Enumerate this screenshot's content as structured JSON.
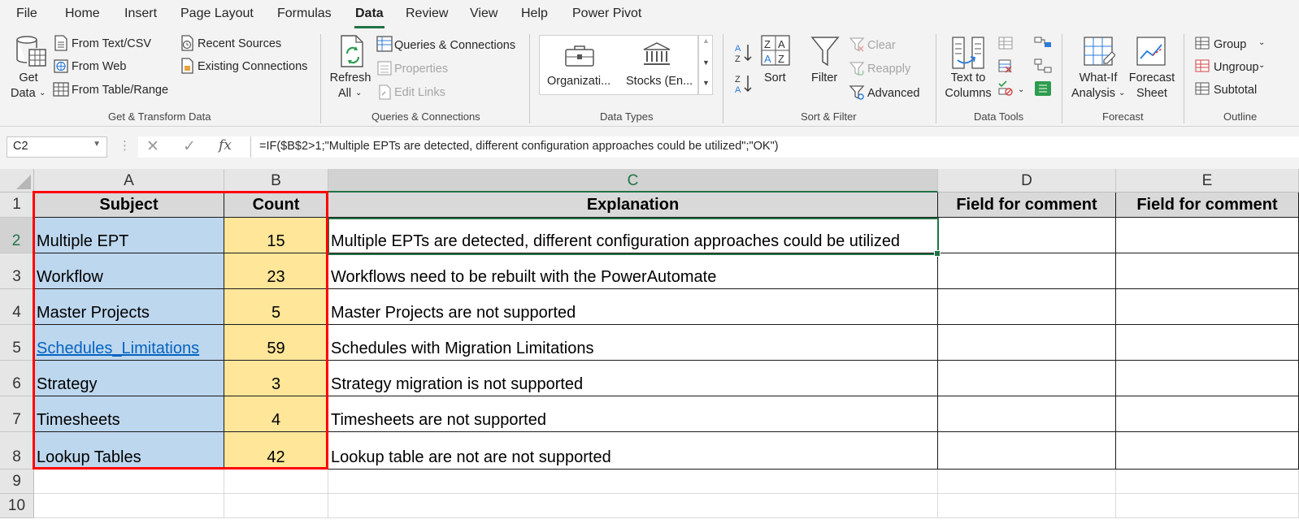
{
  "tabs": [
    "File",
    "Home",
    "Insert",
    "Page Layout",
    "Formulas",
    "Data",
    "Review",
    "View",
    "Help",
    "Power Pivot"
  ],
  "active_tab": "Data",
  "ribbon": {
    "get_transform": {
      "get_data_line1": "Get",
      "get_data_line2": "Data",
      "from_text_csv": "From Text/CSV",
      "from_web": "From Web",
      "from_table_range": "From Table/Range",
      "recent_sources": "Recent Sources",
      "existing_connections": "Existing Connections",
      "group_label": "Get & Transform Data"
    },
    "queries": {
      "refresh_line1": "Refresh",
      "refresh_line2": "All",
      "queries_connections": "Queries & Connections",
      "properties": "Properties",
      "edit_links": "Edit Links",
      "group_label": "Queries & Connections"
    },
    "data_types": {
      "organization": "Organizati...",
      "stocks": "Stocks (En...",
      "group_label": "Data Types"
    },
    "sort_filter": {
      "sort": "Sort",
      "filter": "Filter",
      "clear": "Clear",
      "reapply": "Reapply",
      "advanced": "Advanced",
      "group_label": "Sort & Filter"
    },
    "data_tools": {
      "text_to_columns_line1": "Text to",
      "text_to_columns_line2": "Columns",
      "group_label": "Data Tools"
    },
    "forecast": {
      "what_if_line1": "What-If",
      "what_if_line2": "Analysis",
      "forecast_sheet_line1": "Forecast",
      "forecast_sheet_line2": "Sheet",
      "group_label": "Forecast"
    },
    "outline": {
      "group": "Group",
      "ungroup": "Ungroup",
      "subtotal": "Subtotal",
      "group_label": "Outline"
    }
  },
  "formula_bar": {
    "name_box": "C2",
    "fx": "fx",
    "formula": "=IF($B$2>1;\"Multiple EPTs are detected, different configuration approaches could be utilized\";\"OK\")"
  },
  "sheet": {
    "columns": [
      "A",
      "B",
      "C",
      "D",
      "E"
    ],
    "row_numbers": [
      "1",
      "2",
      "3",
      "4",
      "5",
      "6",
      "7",
      "8",
      "9",
      "10"
    ],
    "headers": {
      "subject": "Subject",
      "count": "Count",
      "explanation": "Explanation",
      "comment_d": "Field for comment",
      "comment_e": "Field for comment"
    },
    "rows": [
      {
        "subject": "Multiple EPT",
        "count": "15",
        "explanation": "Multiple EPTs are detected, different configuration approaches could be utilized"
      },
      {
        "subject": "Workflow",
        "count": "23",
        "explanation": "Workflows need to be rebuilt with the PowerAutomate"
      },
      {
        "subject": "Master Projects",
        "count": "5",
        "explanation": "Master Projects are not supported"
      },
      {
        "subject": "Schedules_Limitations",
        "count": "59",
        "explanation": "Schedules with Migration Limitations"
      },
      {
        "subject": "Strategy",
        "count": "3",
        "explanation": "Strategy migration is not supported"
      },
      {
        "subject": "Timesheets",
        "count": "4",
        "explanation": "Timesheets are not supported"
      },
      {
        "subject": "Lookup Tables",
        "count": "42",
        "explanation": "Lookup table are not are not supported"
      }
    ],
    "active_cell": "C2",
    "hyperlink_row": "Schedules_Limitations",
    "colors": {
      "subject_fill": "#bdd7ee",
      "count_fill": "#ffe699",
      "header_fill": "#d9d9d9",
      "highlight_border": "#ff0000",
      "excel_green": "#217346",
      "link": "#0563c1"
    }
  }
}
